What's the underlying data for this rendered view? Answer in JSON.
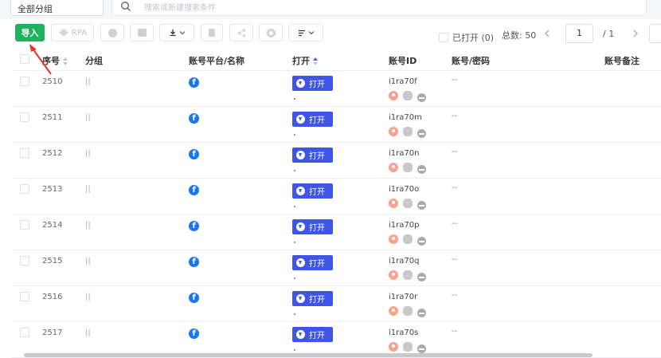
{
  "header": {
    "group_select": "全部分组",
    "search_placeholder": "搜索或新建搜索条件"
  },
  "toolbar": {
    "import_label": "导入",
    "rpa_label": "RPA",
    "opened_label": "已打开 (0)",
    "total_label": "总数: 50",
    "page_current": "1",
    "page_total": "/ 1"
  },
  "table": {
    "headers": {
      "seq": "序号",
      "group": "分组",
      "platform": "账号平台/名称",
      "open": "打开",
      "account_id": "账号ID",
      "account_pwd": "账号/密码",
      "remark": "账号备注"
    },
    "rows": [
      {
        "seq": "2510",
        "group": "||",
        "open_label": "打开",
        "account_id": "i1ra70f",
        "pwd": "--"
      },
      {
        "seq": "2511",
        "group": "||",
        "open_label": "打开",
        "account_id": "i1ra70m",
        "pwd": "--"
      },
      {
        "seq": "2512",
        "group": "||",
        "open_label": "打开",
        "account_id": "i1ra70n",
        "pwd": "--"
      },
      {
        "seq": "2513",
        "group": "||",
        "open_label": "打开",
        "account_id": "i1ra70o",
        "pwd": "--"
      },
      {
        "seq": "2514",
        "group": "||",
        "open_label": "打开",
        "account_id": "i1ra70p",
        "pwd": "--"
      },
      {
        "seq": "2515",
        "group": "||",
        "open_label": "打开",
        "account_id": "i1ra70q",
        "pwd": "--"
      },
      {
        "seq": "2516",
        "group": "||",
        "open_label": "打开",
        "account_id": "i1ra70r",
        "pwd": "--"
      },
      {
        "seq": "2517",
        "group": "||",
        "open_label": "打开",
        "account_id": "i1ra70s",
        "pwd": "--"
      }
    ]
  },
  "colors": {
    "import_green": "#1fb25c",
    "open_blue": "#3f55e8",
    "facebook_blue": "#1877f2",
    "annotation_red": "#e8322c"
  },
  "icons": [
    "search-icon",
    "facebook-icon",
    "location-pin-icon",
    "fingerprint-icon",
    "blocked-icon"
  ]
}
